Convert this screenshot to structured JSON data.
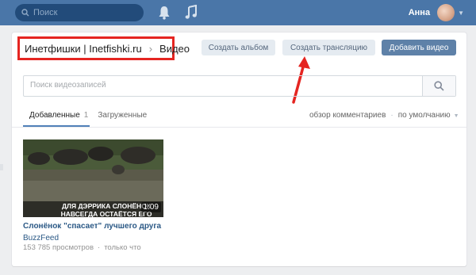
{
  "header": {
    "search_placeholder": "Поиск",
    "user_name": "Анна"
  },
  "breadcrumb": {
    "group": "Инетфишки | Inetfishki.ru",
    "section": "Видео"
  },
  "toolbar": {
    "create_album": "Создать альбом",
    "create_stream": "Создать трансляцию",
    "add_video": "Добавить видео"
  },
  "video_search": {
    "placeholder": "Поиск видеозаписей"
  },
  "tabs": {
    "added_label": "Добавленные",
    "added_count": "1",
    "uploaded_label": "Загруженные"
  },
  "sort": {
    "comments": "обзор комментариев",
    "order": "по умолчанию"
  },
  "videos": [
    {
      "title": "Слонёнок \"спасает\" лучшего друга",
      "author": "BuzzFeed",
      "views": "153 785 просмотров",
      "time": "только что",
      "duration": "1:09",
      "caption": "ДЛЯ ДЭРРИКА СЛОНЁНОК НАВСЕГДА ОСТАЁТСЯ ЕГО"
    }
  ],
  "colors": {
    "header": "#4a76a8",
    "accent": "#5e81a8",
    "highlight": "#e52521"
  }
}
